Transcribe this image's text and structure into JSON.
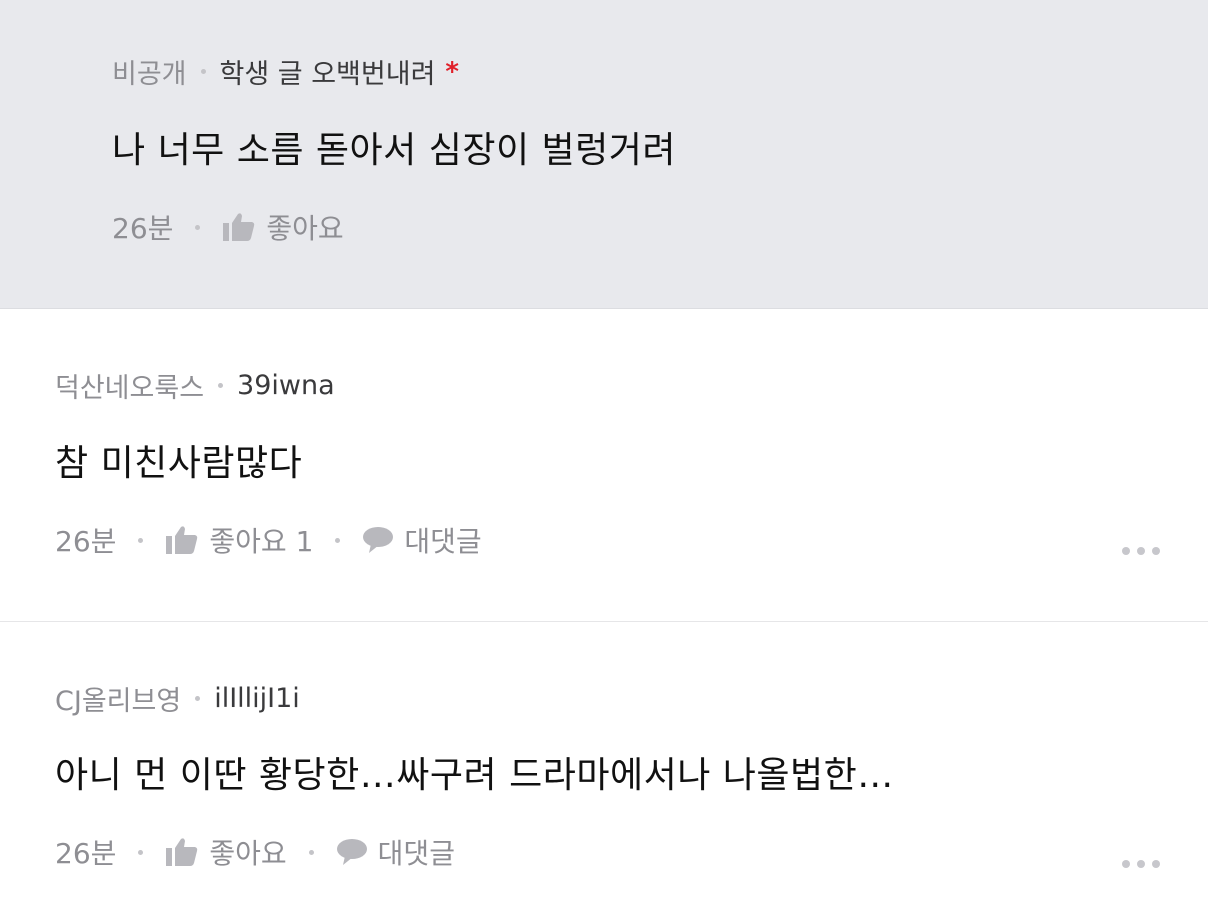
{
  "reply": {
    "school": "비공개",
    "author": "학생 글 오백번내려",
    "author_mark": "*",
    "text": "나 너무 소름 돋아서 심장이 벌렁거려",
    "time": "26분",
    "like_label": "좋아요"
  },
  "comments": [
    {
      "school": "덕산네오룩스",
      "author": "39iwna",
      "text": "참 미친사람많다",
      "time": "26분",
      "like_label": "좋아요 1",
      "reply_label": "대댓글"
    },
    {
      "school": "CJ올리브영",
      "author": "ilIllijI1i",
      "text": "아니 먼 이딴 황당한…싸구려 드라마에서나 나올법한…",
      "time": "26분",
      "like_label": "좋아요",
      "reply_label": "대댓글"
    }
  ],
  "icons": {
    "like": "thumbs-up-icon",
    "reply": "speech-bubble-icon",
    "more": "more-dots-icon"
  },
  "colors": {
    "reply_bg": "#e8e9ed",
    "star": "#e0202a",
    "muted": "#8e8e93"
  }
}
